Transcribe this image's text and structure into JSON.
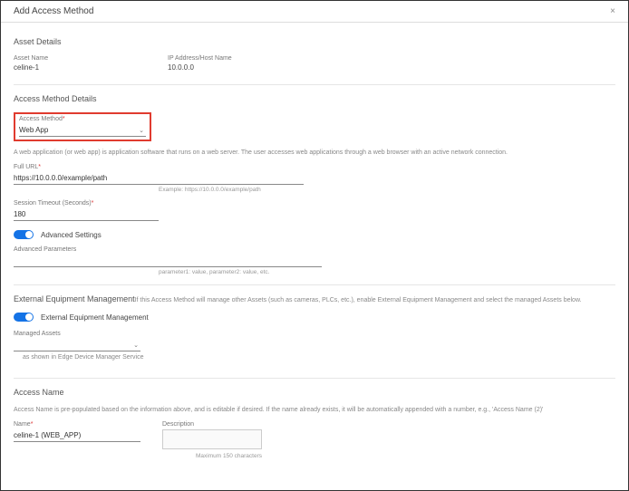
{
  "dialog": {
    "title": "Add Access Method"
  },
  "asset_details": {
    "heading": "Asset Details",
    "asset_name_label": "Asset Name",
    "asset_name_value": "celine-1",
    "ip_label": "IP Address/Host Name",
    "ip_value": "10.0.0.0"
  },
  "method_details": {
    "heading": "Access Method Details",
    "method_label": "Access Method",
    "method_value": "Web App",
    "method_desc": "A web application (or web app) is application software that runs on a web server. The user accesses web applications through a web browser with an active network connection.",
    "url_label": "Full URL",
    "url_value": "https://10.0.0.0/example/path",
    "url_example": "Example: https://10.0.0.0/example/path",
    "timeout_label": "Session Timeout (Seconds)",
    "timeout_value": "180",
    "advanced_label": "Advanced Settings",
    "adv_params_label": "Advanced Parameters",
    "adv_params_value": "",
    "adv_params_example": "parameter1: value, parameter2: value, etc."
  },
  "ext_equip": {
    "heading": "External Equipment Management",
    "heading_desc": "If this Access Method will manage other Assets (such as cameras, PLCs, etc.), enable External Equipment Management and select the managed Assets below.",
    "toggle_label": "External Equipment Management",
    "managed_label": "Managed Assets",
    "managed_value": "",
    "managed_hint": "as shown in Edge Device Manager Service"
  },
  "access_name": {
    "heading": "Access Name",
    "desc": "Access Name is pre-populated based on the information above, and is editable if desired. If the name already exists, it will be automatically appended with a number, e.g., 'Access Name (2)'",
    "name_label": "Name",
    "name_value": "celine-1 (WEB_APP)",
    "description_label": "Description",
    "description_value": "",
    "max_chars": "Maximum 150 characters"
  }
}
